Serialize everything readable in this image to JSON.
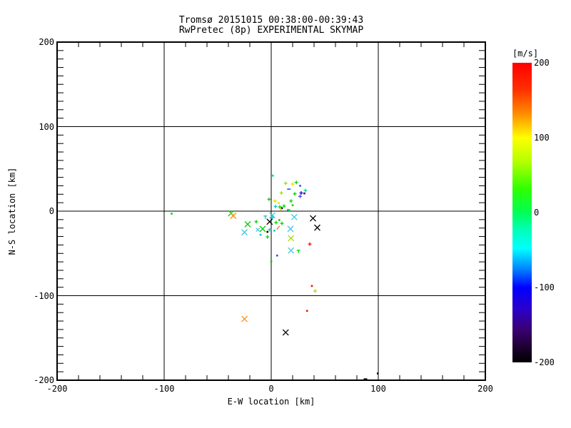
{
  "title": {
    "line1": "Tromsø 20151015 00:38:00-00:39:43",
    "line2": "RwPretec (8p) EXPERIMENTAL SKYMAP"
  },
  "chart_data": {
    "type": "scatter",
    "title": "Tromsø 20151015 00:38:00-00:39:43 / RwPretec (8p) EXPERIMENTAL SKYMAP",
    "xlabel": "E-W location [km]",
    "ylabel": "N-S location [km]",
    "xlim": [
      -200,
      200
    ],
    "ylim": [
      -200,
      200
    ],
    "x_tick_labels": [
      "-200",
      "-100",
      "0",
      "100",
      "200"
    ],
    "y_tick_labels": [
      "200",
      "100",
      "0",
      "-100",
      "-200"
    ],
    "x_ticks": [
      -200,
      -100,
      0,
      100,
      200
    ],
    "y_ticks": [
      200,
      100,
      0,
      -100,
      -200
    ],
    "x_minor_step": 20,
    "y_minor_step": 10,
    "grid": true,
    "legend_position": "none",
    "colorbar": {
      "label": "[m/s]",
      "tick_labels": [
        "200",
        "100",
        "0",
        "-100",
        "-200"
      ],
      "ticks": [
        200,
        100,
        0,
        -100,
        -200
      ],
      "range_top": 200,
      "range_bottom": -200,
      "gradient_stops": [
        {
          "pos": 0,
          "color": "#ff0000"
        },
        {
          "pos": 9,
          "color": "#ff3000"
        },
        {
          "pos": 17,
          "color": "#ff8c00"
        },
        {
          "pos": 25,
          "color": "#ffff00"
        },
        {
          "pos": 33,
          "color": "#b4ff00"
        },
        {
          "pos": 42,
          "color": "#30ff00"
        },
        {
          "pos": 50,
          "color": "#00ff55"
        },
        {
          "pos": 56,
          "color": "#00ffbb"
        },
        {
          "pos": 62,
          "color": "#00ffff"
        },
        {
          "pos": 69,
          "color": "#0080ff"
        },
        {
          "pos": 75,
          "color": "#0000ff"
        },
        {
          "pos": 82,
          "color": "#2a00cc"
        },
        {
          "pos": 89,
          "color": "#3a0073"
        },
        {
          "pos": 95,
          "color": "#1d0030"
        },
        {
          "pos": 100,
          "color": "#000000"
        }
      ]
    },
    "points": [
      {
        "x": -37.5,
        "y": -2.5,
        "c": "#00d400",
        "m": "X"
      },
      {
        "x": -35.5,
        "y": -5.5,
        "c": "#ff8c1a",
        "m": "X"
      },
      {
        "x": -22,
        "y": -15.5,
        "c": "#00d400",
        "m": "X"
      },
      {
        "x": -25,
        "y": -25,
        "c": "#45c8e0",
        "m": "X"
      },
      {
        "x": -12.5,
        "y": -22,
        "c": "#45c8e0",
        "m": "x"
      },
      {
        "x": -8,
        "y": -21,
        "c": "#00d400",
        "m": "X"
      },
      {
        "x": -1.5,
        "y": -12.5,
        "c": "#000000",
        "m": "X"
      },
      {
        "x": 1,
        "y": -5,
        "c": "#45c8e0",
        "m": "X"
      },
      {
        "x": 21.5,
        "y": -7,
        "c": "#45c8e0",
        "m": "X"
      },
      {
        "x": 18,
        "y": -21,
        "c": "#45c8e0",
        "m": "X"
      },
      {
        "x": 18.5,
        "y": -32,
        "c": "#a0dc00",
        "m": "X"
      },
      {
        "x": 18.5,
        "y": -46.5,
        "c": "#45c8e0",
        "m": "X"
      },
      {
        "x": 39,
        "y": -8.5,
        "c": "#000000",
        "m": "X"
      },
      {
        "x": 43,
        "y": -19.5,
        "c": "#000000",
        "m": "X"
      },
      {
        "x": -25,
        "y": -127.5,
        "c": "#ff8c1a",
        "m": "X"
      },
      {
        "x": 13.5,
        "y": -143.5,
        "c": "#000000",
        "m": "X"
      },
      {
        "x": -93,
        "y": -3,
        "c": "#00d400",
        "m": "."
      },
      {
        "x": 1.5,
        "y": 42,
        "c": "#00dc82",
        "m": "."
      },
      {
        "x": 13.5,
        "y": 33,
        "c": "#a0dc00",
        "m": "+"
      },
      {
        "x": 20,
        "y": 32,
        "c": "#e0e000",
        "m": "+"
      },
      {
        "x": 23.5,
        "y": 34,
        "c": "#00d400",
        "m": "+"
      },
      {
        "x": 16.5,
        "y": 26,
        "c": "#2850ff",
        "m": "-"
      },
      {
        "x": 27,
        "y": 30,
        "c": "#2850ff",
        "m": "."
      },
      {
        "x": 32,
        "y": 24.5,
        "c": "#00dc82",
        "m": "+"
      },
      {
        "x": 31,
        "y": 21,
        "c": "#500073",
        "m": "."
      },
      {
        "x": 28,
        "y": 21.5,
        "c": "#2800c8",
        "m": "+"
      },
      {
        "x": 27,
        "y": 17.5,
        "c": "#2850ff",
        "m": "+"
      },
      {
        "x": 22,
        "y": 20.5,
        "c": "#00d400",
        "m": "+"
      },
      {
        "x": 9.5,
        "y": 21.5,
        "c": "#a0dc00",
        "m": "+"
      },
      {
        "x": -2,
        "y": 14,
        "c": "#00d400",
        "m": "+"
      },
      {
        "x": 3.5,
        "y": 12,
        "c": "#e0e000",
        "m": "+"
      },
      {
        "x": 7,
        "y": 9.5,
        "c": "#e0e000",
        "m": "."
      },
      {
        "x": 4,
        "y": 5.5,
        "c": "#00c8c8",
        "m": "+"
      },
      {
        "x": 8,
        "y": 5,
        "c": "#00d400",
        "m": "+"
      },
      {
        "x": 10,
        "y": 3.5,
        "c": "#000000",
        "m": "."
      },
      {
        "x": 9,
        "y": 2,
        "c": "#e0e000",
        "m": "."
      },
      {
        "x": 12,
        "y": 6,
        "c": "#00d400",
        "m": "+"
      },
      {
        "x": 18.5,
        "y": 12,
        "c": "#00d400",
        "m": "+"
      },
      {
        "x": 20,
        "y": 7,
        "c": "#00d400",
        "m": "."
      },
      {
        "x": 15.5,
        "y": 1.5,
        "c": "#00c8c8",
        "m": "."
      },
      {
        "x": 17,
        "y": 1,
        "c": "#00d400",
        "m": "."
      },
      {
        "x": 1.5,
        "y": -7,
        "c": "#00c8c8",
        "m": "+"
      },
      {
        "x": -5.5,
        "y": -7,
        "c": "#00c8c8",
        "m": "T"
      },
      {
        "x": 10,
        "y": -14.5,
        "c": "#00d400",
        "m": "+"
      },
      {
        "x": 4.5,
        "y": -13.5,
        "c": "#00d400",
        "m": "+"
      },
      {
        "x": 7.5,
        "y": -10.5,
        "c": "#00d400",
        "m": "."
      },
      {
        "x": 6.5,
        "y": -19.5,
        "c": "#ff6a00",
        "m": "/"
      },
      {
        "x": -14,
        "y": -12.5,
        "c": "#00d400",
        "m": "+"
      },
      {
        "x": -1.5,
        "y": -22,
        "c": "#00c8c8",
        "m": "+"
      },
      {
        "x": 3,
        "y": -23,
        "c": "#00c8c8",
        "m": "."
      },
      {
        "x": -3.5,
        "y": -24.5,
        "c": "#000000",
        "m": "."
      },
      {
        "x": -10,
        "y": -28,
        "c": "#00c8c8",
        "m": "."
      },
      {
        "x": -3.5,
        "y": -30.5,
        "c": "#00d400",
        "m": "+"
      },
      {
        "x": 36,
        "y": -39,
        "c": "#ee1400",
        "m": "+"
      },
      {
        "x": 25.5,
        "y": -47.5,
        "c": "#00d400",
        "m": "T"
      },
      {
        "x": 5.5,
        "y": -52.5,
        "c": "#2850ff",
        "m": "."
      },
      {
        "x": 0,
        "y": -59.5,
        "c": "#00d400",
        "m": "."
      },
      {
        "x": 38,
        "y": -88.5,
        "c": "#ee1400",
        "m": "."
      },
      {
        "x": 41,
        "y": -94.5,
        "c": "#a0dc00",
        "m": "+"
      },
      {
        "x": 33.5,
        "y": -118,
        "c": "#ee1400",
        "m": "."
      },
      {
        "x": 88,
        "y": -198.5,
        "c": "#000000",
        "m": "-"
      },
      {
        "x": 99.5,
        "y": -192,
        "c": "#000000",
        "m": "."
      }
    ]
  }
}
